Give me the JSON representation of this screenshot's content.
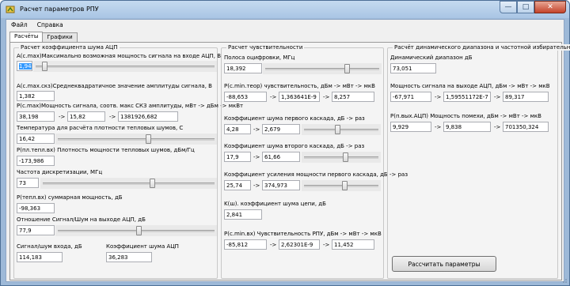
{
  "window": {
    "title": "Расчет параметров РПУ"
  },
  "menu": {
    "file": "Файл",
    "help": "Справка"
  },
  "tabs": {
    "calc": "Расчёты",
    "graphs": "Графики"
  },
  "left": {
    "group_title": "Расчет коэффициента шума АЦП",
    "amax_label": "A(c.max)Максимально возможная мощность сигнала на входе АЦП, В",
    "amax_value": "1,942",
    "amax_slider": 0.05,
    "asko_label": "A(c.max.cкз)Среднеквадратичное значение амплитуды сигнала, В",
    "asko_value": "1,382",
    "pmax_label": "P(c.max)Мощность сигнала, соотв. макс СКЗ амплитуды, мВт -> дБм -> мкВт",
    "pmax_v1": "38,198",
    "pmax_v2": "15,82",
    "pmax_v3": "1381926,682",
    "temp_label": "Температура для расчёта плотности тепловых шумов, С",
    "temp_value": "16,42",
    "temp_slider": 0.58,
    "pn_label": "P(пл.тепл.вх) Плотность мощности тепловых шумов,  дБм/Гц",
    "pn_value": "-173,986",
    "freq_label": "Частота дискретизации, МГц",
    "freq_value": "73",
    "freq_slider": 0.64,
    "ptot_label": "P(тепл.вх) суммарная мощность, дБ",
    "ptot_value": "-98,363",
    "snr_label": "Отношение Сигнал/Шум на выходе АЦП, дБ",
    "snr_value": "77,9",
    "snr_slider": 0.52,
    "snr_in_label": "Сигнал/шум входа, дБ",
    "snr_in_value": "114,183",
    "nf_adc_label": "Коэффициент шума АЦП",
    "nf_adc_value": "36,283"
  },
  "mid": {
    "group_title": "Расчет чувствительности",
    "bw_label": "Полоса оцифровки, МГц",
    "bw_value": "18,392",
    "bw_slider": 0.72,
    "sens_th_label": "P(c.min.теор) чувствительность, дБм -> мВт -> мкВ",
    "sens_th_v1": "-88,653",
    "sens_th_v2": "1,363641E-9",
    "sens_th_v3": "8,257",
    "nf1_label": "Коэффициент шума первого каскада, дБ -> раз",
    "nf1_v1": "4,28",
    "nf1_v2": "2,679",
    "nf1_slider": 0.45,
    "nf2_label": "Коэффициент шума второго каскада, дБ -> раз",
    "nf2_v1": "17,9",
    "nf2_v2": "61,66",
    "nf2_slider": 0.56,
    "g1_label": "Коэффициент усиления мощности первого каскада, дБ -> раз",
    "g1_v1": "25,74",
    "g1_v2": "374,973",
    "g1_slider": 0.55,
    "nf_chain_label": "K(ш). коэффициент шума цепи, дБ",
    "nf_chain_value": "2,841",
    "sens_label": "P(c.min.вх) Чувствительность РПУ, дБм -> мВт -> мкВ",
    "sens_v1": "-85,812",
    "sens_v2": "2,62301E-9",
    "sens_v3": "11,452"
  },
  "right": {
    "group_title": "Расчёт динамического диапазона и частотной избирательности",
    "dr_label": "Динамический диапазон дБ",
    "dr_value": "73,051",
    "pout_label": "Мощность сигнала на выходе АЦП, дБм -> мВт -> мкВ",
    "pout_v1": "-67,971",
    "pout_v2": "1,59551172E-7",
    "pout_v3": "89,317",
    "pint_label": "P(п.вых.АЦП) Мощность помехи, дБм -> мВт -> мкВ",
    "pint_v1": "9,929",
    "pint_v2": "9,838",
    "pint_v3": "701350,324",
    "calc_button": "Рассчитать параметры"
  },
  "arrow": "->"
}
